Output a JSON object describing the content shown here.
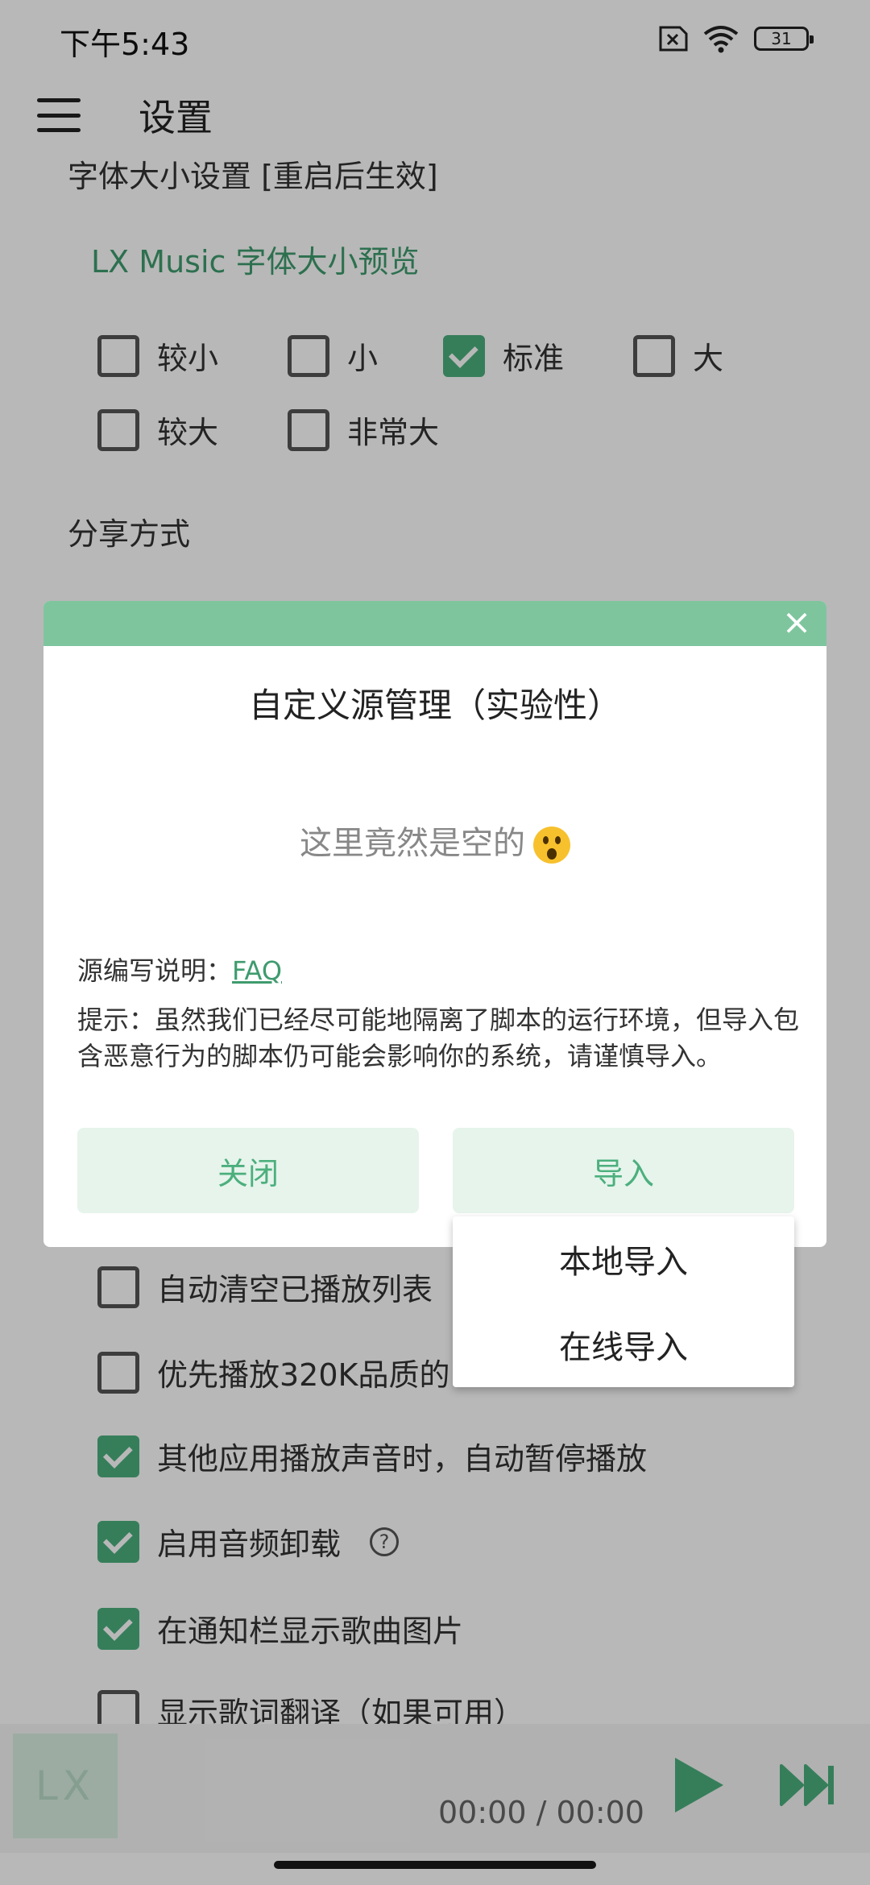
{
  "status_bar": {
    "time": "下午5:43",
    "battery": "31"
  },
  "app_bar": {
    "title": "设置",
    "menu_icon": "hamburger-menu-icon"
  },
  "font_size": {
    "section_title": "字体大小设置 [重启后生效]",
    "preview": "LX Music 字体大小预览",
    "options": [
      {
        "label": "较小",
        "checked": false
      },
      {
        "label": "小",
        "checked": false
      },
      {
        "label": "标准",
        "checked": true
      },
      {
        "label": "大",
        "checked": false
      },
      {
        "label": "较大",
        "checked": false
      },
      {
        "label": "非常大",
        "checked": false
      }
    ]
  },
  "share": {
    "section_title": "分享方式"
  },
  "play_options": [
    {
      "label": "自动清空已播放列表",
      "checked": false
    },
    {
      "label": "优先播放320K品质的",
      "checked": false
    },
    {
      "label": "其他应用播放声音时，自动暂停播放",
      "checked": true
    },
    {
      "label": "启用音频卸载",
      "checked": true
    },
    {
      "label": "在通知栏显示歌曲图片",
      "checked": true
    },
    {
      "label": "显示歌词翻译（如果可用）",
      "checked": false
    }
  ],
  "player": {
    "logo": "LX",
    "time": "00:00 / 00:00"
  },
  "dialog": {
    "title": "自定义源管理（实验性）",
    "empty_text": "这里竟然是空的",
    "faq_label": "源编写说明：",
    "faq_link": "FAQ",
    "tip": "提示：虽然我们已经尽可能地隔离了脚本的运行环境，但导入包含恶意行为的脚本仍可能会影响你的系统，请谨慎导入。",
    "close_button": "关闭",
    "import_button": "导入",
    "close_icon": "×"
  },
  "import_menu": {
    "items": [
      "本地导入",
      "在线导入"
    ]
  },
  "colors": {
    "accent": "#4caf7d",
    "header": "#7ec59e",
    "button_bg": "#e6f4ec"
  }
}
